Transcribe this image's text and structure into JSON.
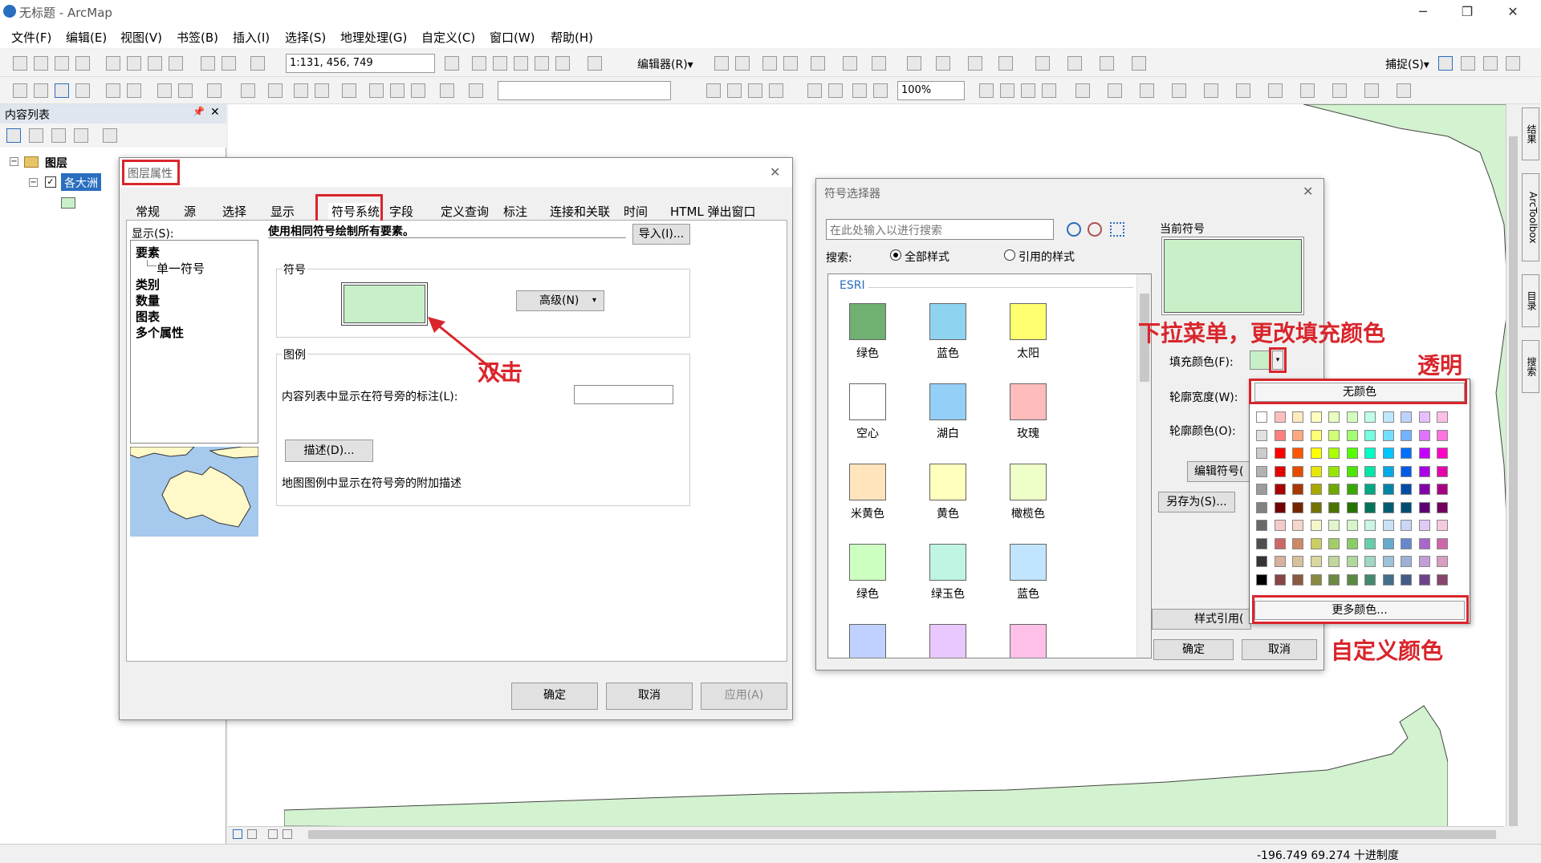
{
  "window": {
    "title": "无标题 - ArcMap",
    "min": "─",
    "restore": "❐",
    "close": "✕"
  },
  "menu": [
    "文件(F)",
    "编辑(E)",
    "视图(V)",
    "书签(B)",
    "插入(I)",
    "选择(S)",
    "地理处理(G)",
    "自定义(C)",
    "窗口(W)",
    "帮助(H)"
  ],
  "toolbar": {
    "scale": "1:131, 456, 749",
    "editor": "编辑器(R)▾",
    "zoom": "100%",
    "snap": "捕捉(S)▾"
  },
  "toc": {
    "header": "内容列表",
    "pin": "📌",
    "close": "✕",
    "root": "图层",
    "layer": "各大洲"
  },
  "status": {
    "coords": "-196.749  69.274 十进制度"
  },
  "layer_props": {
    "title": "图层属性",
    "close": "✕",
    "tabs": [
      "常规",
      "源",
      "选择",
      "显示",
      "符号系统",
      "字段",
      "定义查询",
      "标注",
      "连接和关联",
      "时间",
      "HTML 弹出窗口"
    ],
    "show_label": "显示(S):",
    "show_items": [
      "要素",
      "单一符号",
      "类别",
      "数量",
      "图表",
      "多个属性"
    ],
    "desc": "使用相同符号绘制所有要素。",
    "import": "导入(I)...",
    "symbol_group": "符号",
    "advanced": "高级(N)",
    "legend_group": "图例",
    "legend_label": "内容列表中显示在符号旁的标注(L):",
    "describe": "描述(D)...",
    "describe_note": "地图图例中显示在符号旁的附加描述",
    "ok": "确定",
    "cancel": "取消",
    "apply": "应用(A)"
  },
  "symbol_selector": {
    "title": "符号选择器",
    "close": "✕",
    "search_placeholder": "在此处输入以进行搜索",
    "search_label": "搜索:",
    "radio_all": "全部样式",
    "radio_ref": "引用的样式",
    "group": "ESRI",
    "symbols": [
      {
        "name": "绿色",
        "color": "#70b070"
      },
      {
        "name": "蓝色",
        "color": "#8ed4f0"
      },
      {
        "name": "太阳",
        "color": "#ffff70"
      },
      {
        "name": "空心",
        "color": "#ffffff"
      },
      {
        "name": "湖白",
        "color": "#94cff7"
      },
      {
        "name": "玫瑰",
        "color": "#ffbcbc"
      },
      {
        "name": "米黄色",
        "color": "#ffe4bc"
      },
      {
        "name": "黄色",
        "color": "#ffffbe"
      },
      {
        "name": "橄榄色",
        "color": "#eeffc8"
      },
      {
        "name": "绿色",
        "color": "#ccffc0"
      },
      {
        "name": "绿玉色",
        "color": "#bff5e2"
      },
      {
        "name": "蓝色",
        "color": "#c2e5ff"
      }
    ],
    "partial_row": [
      "#c0d0ff",
      "#e8c8ff",
      "#ffc0e8"
    ],
    "current_label": "当前符号",
    "fill_label": "填充颜色(F):",
    "outline_width": "轮廓宽度(W):",
    "outline_color": "轮廓颜色(O):",
    "edit_symbol": "编辑符号(",
    "save_as": "另存为(S)...",
    "style_ref": "样式引用(",
    "ok": "确定",
    "cancel": "取消"
  },
  "palette": {
    "no_color": "无颜色",
    "more": "更多颜色...",
    "rows": [
      [
        "#ffffff",
        "#ffbebe",
        "#ffebbe",
        "#ffffbe",
        "#e9ffbe",
        "#d3ffbe",
        "#beffe8",
        "#bee8ff",
        "#bed2ff",
        "#e8beff",
        "#ffbee8"
      ],
      [
        "#e1e1e1",
        "#ff7f7f",
        "#ffa77f",
        "#ffff73",
        "#d1ff73",
        "#a3ff73",
        "#73ffdf",
        "#73dfff",
        "#73b2ff",
        "#df73ff",
        "#ff73df"
      ],
      [
        "#cccccc",
        "#ff0000",
        "#ff5500",
        "#ffff00",
        "#aaff00",
        "#55ff00",
        "#00ffc5",
        "#00c5ff",
        "#0070ff",
        "#c500ff",
        "#ff00c5"
      ],
      [
        "#b2b2b2",
        "#e60000",
        "#e64c00",
        "#e6e600",
        "#98e600",
        "#4ce600",
        "#00e6a9",
        "#00a9e6",
        "#005ce6",
        "#a900e6",
        "#e600a9"
      ],
      [
        "#9c9c9c",
        "#a80000",
        "#a83800",
        "#a8a800",
        "#70a800",
        "#38a800",
        "#00a884",
        "#0084a8",
        "#004da8",
        "#8400a8",
        "#a80084"
      ],
      [
        "#828282",
        "#730000",
        "#732600",
        "#737300",
        "#4c7300",
        "#267300",
        "#00735c",
        "#005c73",
        "#004c73",
        "#5c0073",
        "#73005c"
      ],
      [
        "#686868",
        "#f5caca",
        "#f5d6ca",
        "#f5f5ca",
        "#e1f5ca",
        "#d6f5ca",
        "#caf5e1",
        "#cae1f5",
        "#cad6f5",
        "#e1caf5",
        "#f5cae1"
      ],
      [
        "#4e4e4e",
        "#cd6666",
        "#cd8966",
        "#cdcd66",
        "#a3cd66",
        "#89cd66",
        "#66cdab",
        "#66abcd",
        "#6689cd",
        "#ab66cd",
        "#cd66ab"
      ],
      [
        "#343434",
        "#d7b09e",
        "#d7c29e",
        "#d7d79e",
        "#c2d79e",
        "#b0d79e",
        "#9ed7c2",
        "#9ec2d7",
        "#9eb0d7",
        "#c29ed7",
        "#d79ec2"
      ],
      [
        "#000000",
        "#894444",
        "#895a44",
        "#898944",
        "#6e8944",
        "#5a8944",
        "#44896e",
        "#446e89",
        "#445a89",
        "#6e4489",
        "#89446e"
      ]
    ]
  },
  "annotations": {
    "dblclick": "双击",
    "dropdown": "下拉菜单，更改填充颜色",
    "transparent": "透明",
    "custom": "自定义颜色"
  },
  "sidetabs": [
    "结果",
    "ArcToolbox",
    "目录",
    "搜索"
  ]
}
